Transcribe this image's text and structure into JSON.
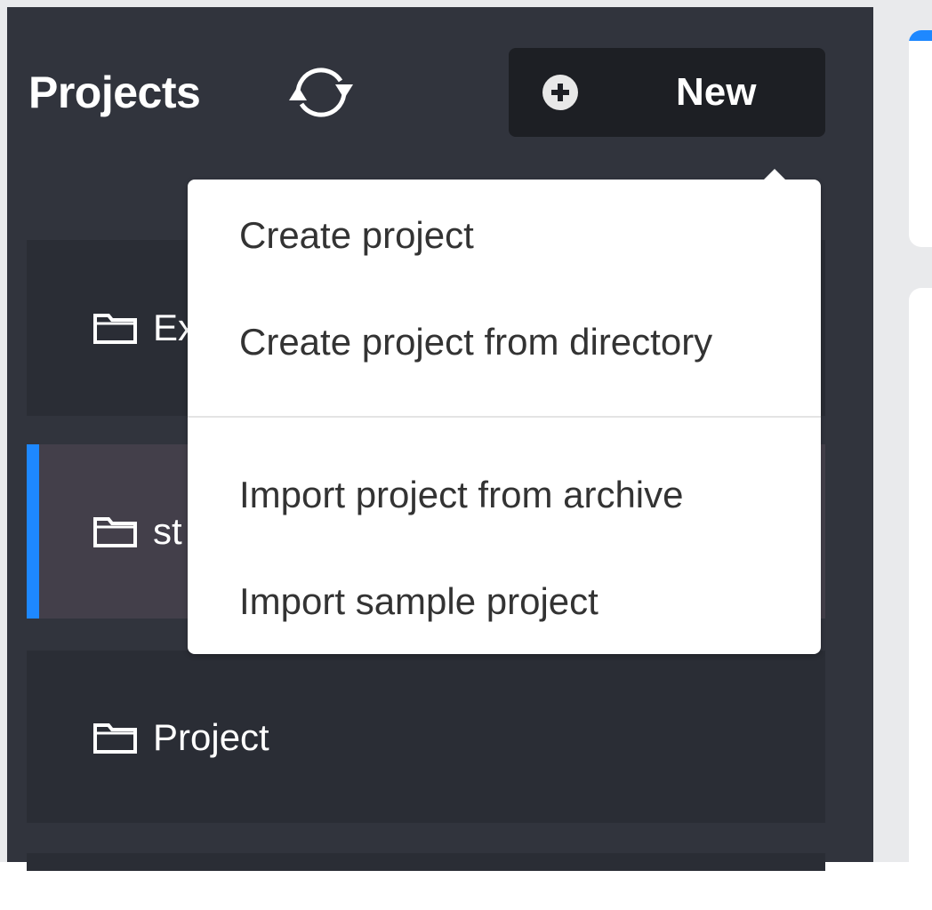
{
  "sidebar": {
    "title": "Projects",
    "new_button_label": "New",
    "projects": [
      {
        "label": "Ex"
      },
      {
        "label": "st"
      },
      {
        "label": "Project"
      }
    ]
  },
  "new_menu": {
    "items": [
      {
        "label": "Create project"
      },
      {
        "label": "Create project from directory"
      },
      {
        "label": "Import project from archive"
      },
      {
        "label": "Import sample project"
      }
    ]
  },
  "colors": {
    "sidebar_bg": "#31343d",
    "row_bg": "#2a2d35",
    "selected_row_bg": "#433f4a",
    "accent": "#1e88ff",
    "button_bg": "#1d1f24"
  },
  "icons": {
    "refresh": "refresh-icon",
    "add": "plus-circle-icon",
    "folder": "folder-icon"
  }
}
